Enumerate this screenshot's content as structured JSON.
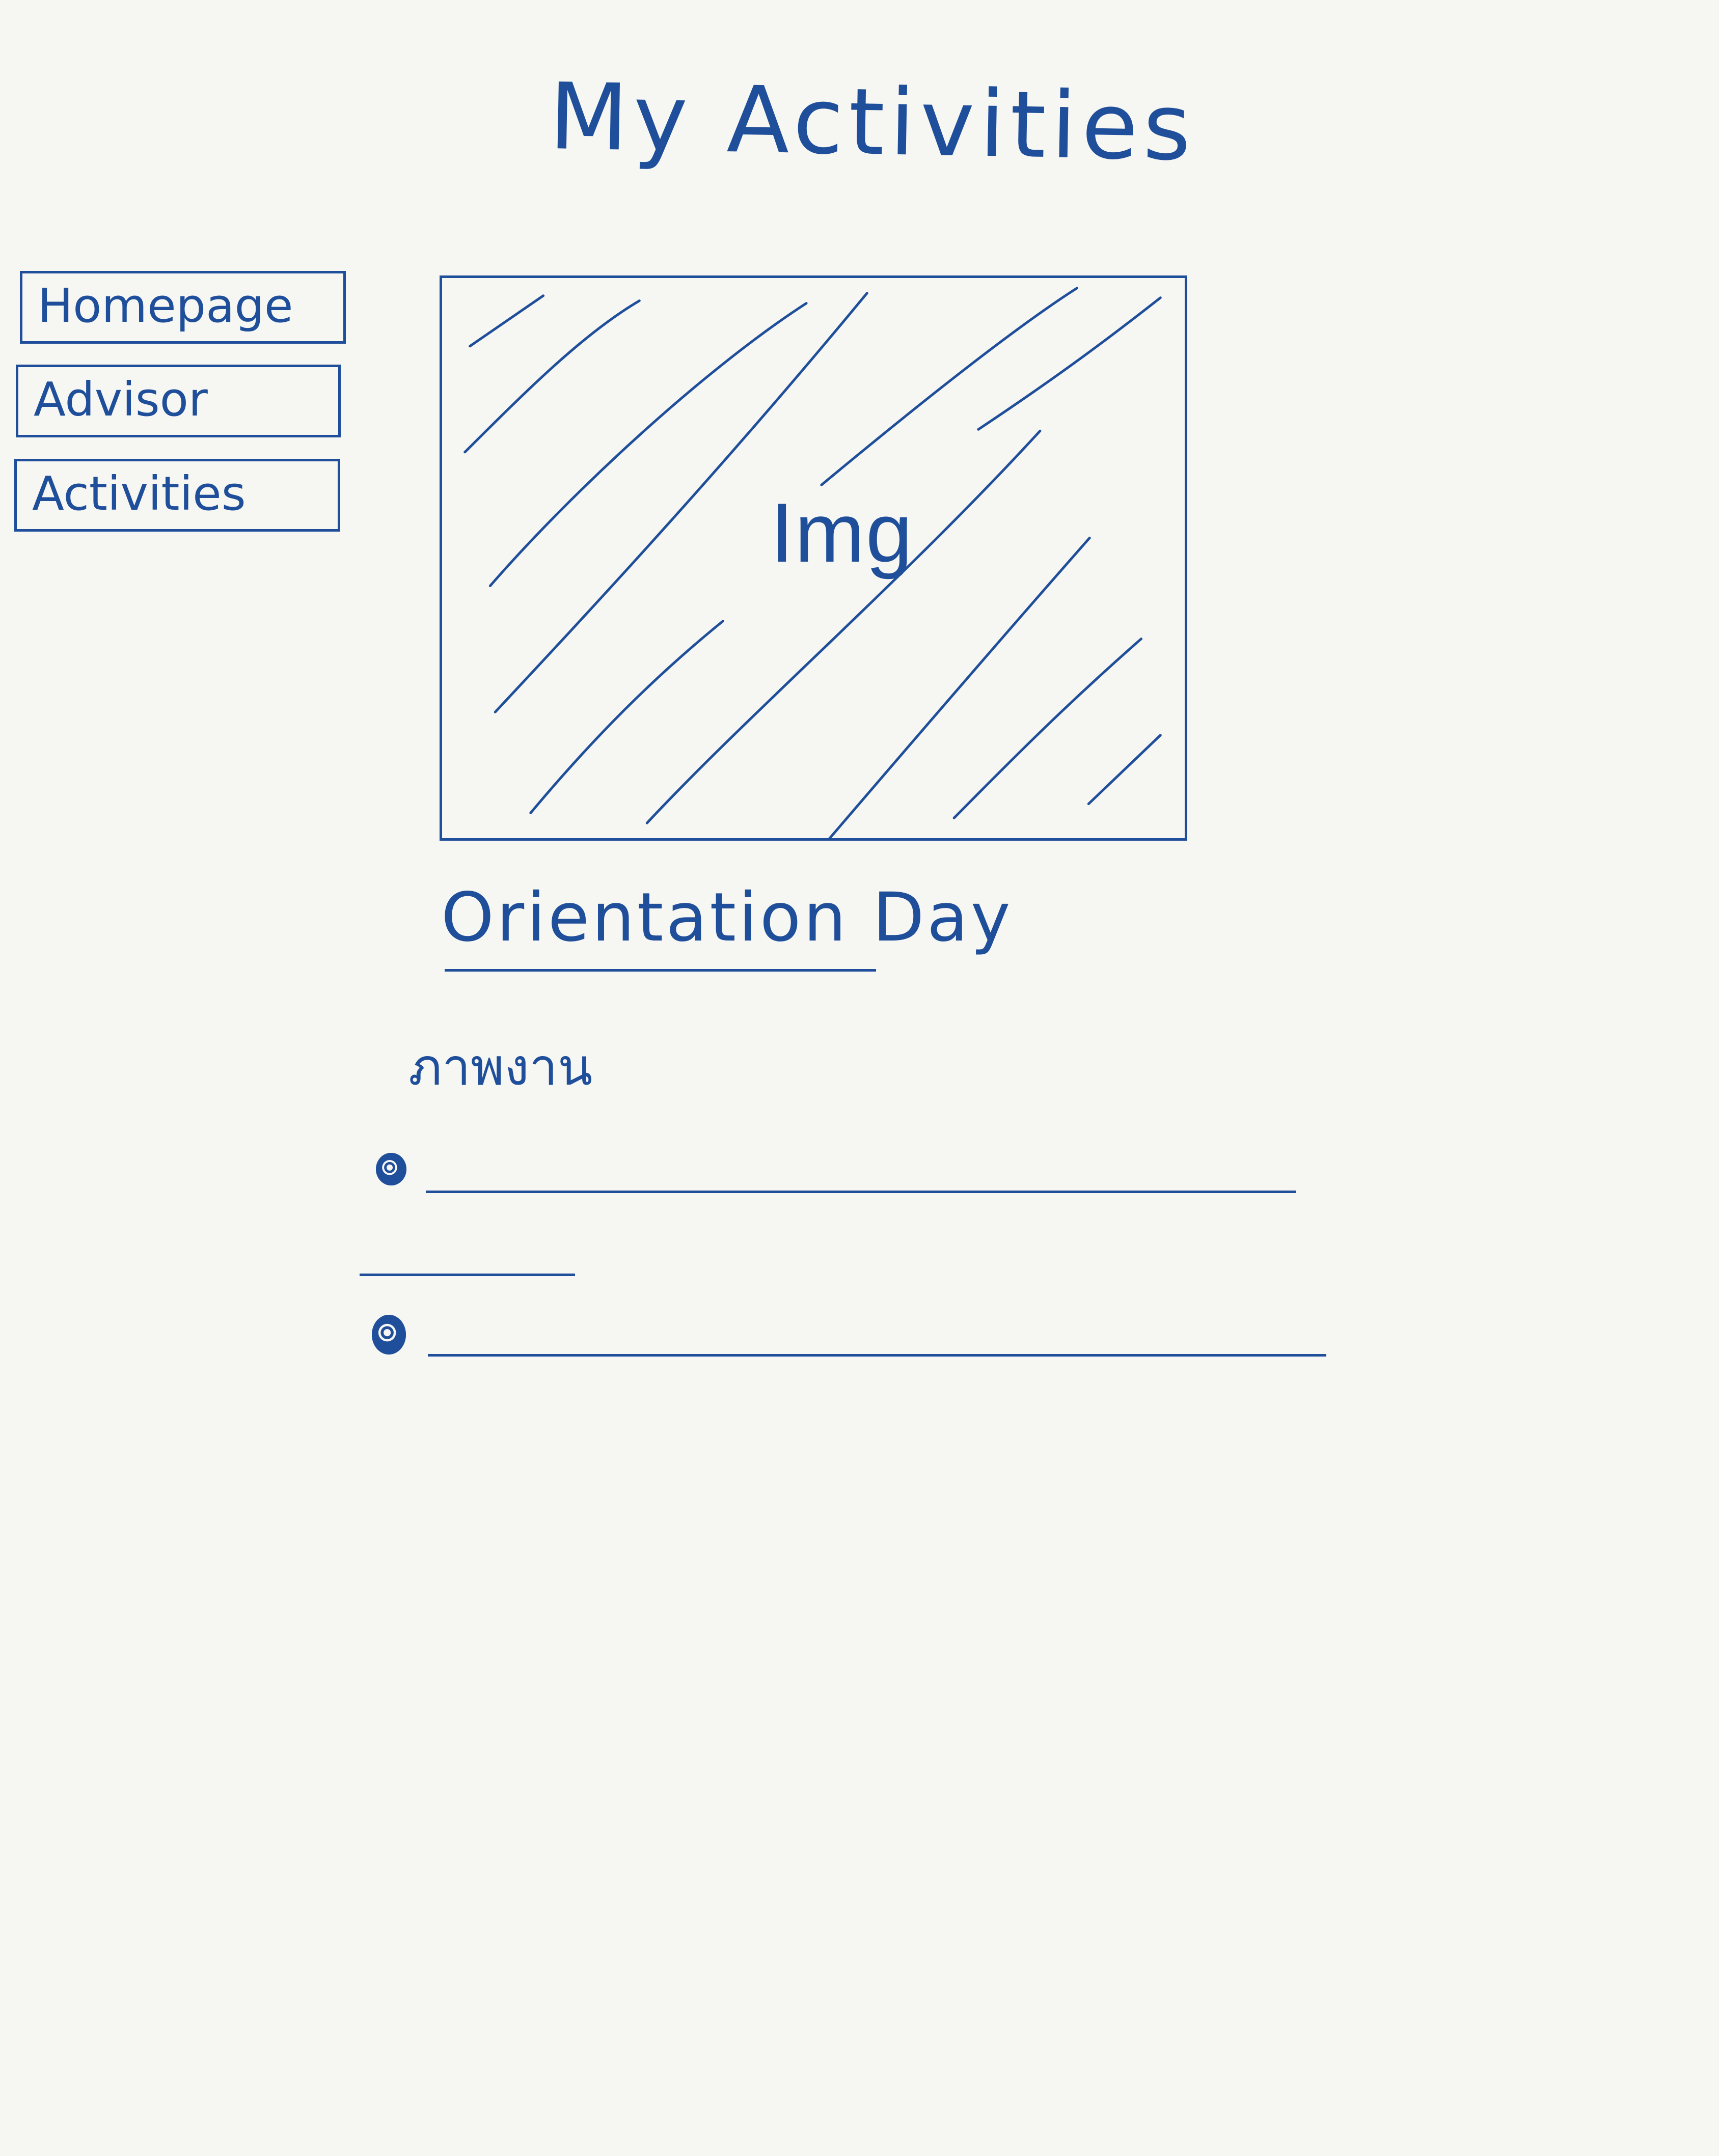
{
  "header": {
    "title": "My Activities"
  },
  "sidebar": {
    "items": [
      {
        "label": "Homepage"
      },
      {
        "label": "Advisor"
      },
      {
        "label": "Activities"
      }
    ]
  },
  "main": {
    "image_placeholder_label": "Img",
    "event_title": "Orientation Day",
    "thai_label": "ภาพงาน"
  }
}
